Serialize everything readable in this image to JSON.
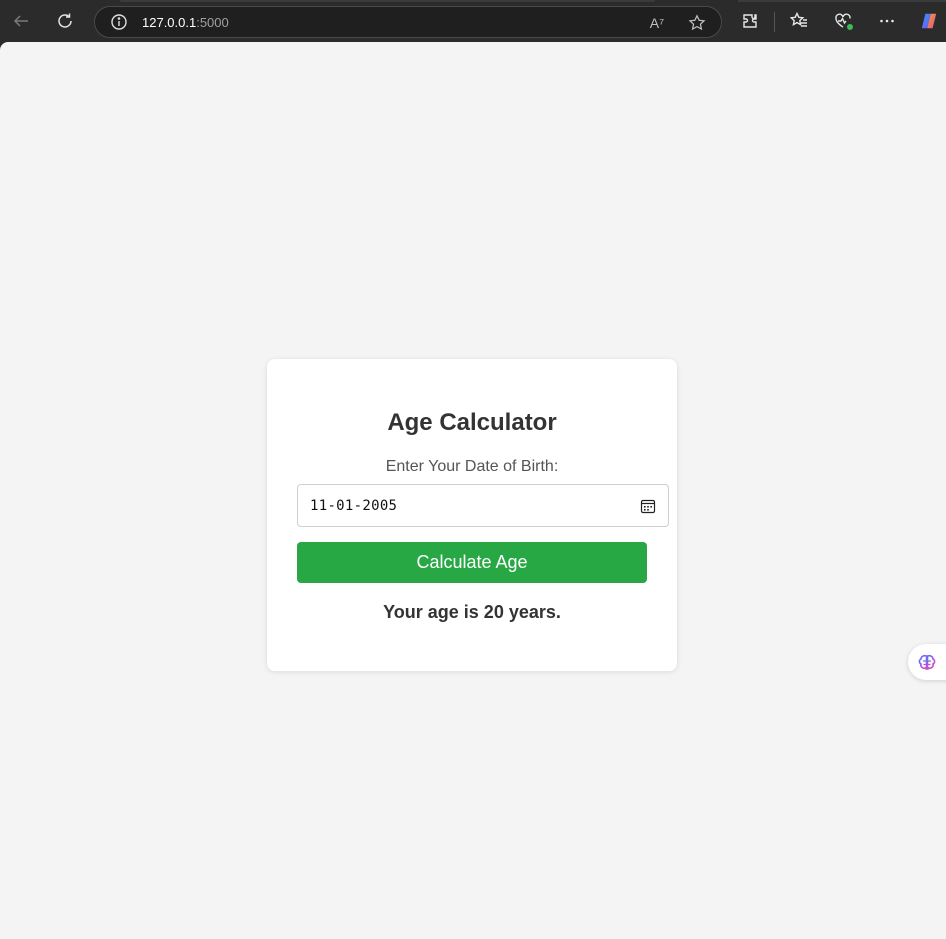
{
  "browser": {
    "url_host": "127.0.0.1",
    "url_port": ":5000",
    "icons": {
      "back": "back-arrow-icon",
      "reload": "reload-icon",
      "info": "info-icon",
      "read_aloud": "read-aloud-icon",
      "favorite": "star-icon",
      "extensions": "extensions-icon",
      "favorites": "favorites-icon",
      "health": "browser-essentials-icon",
      "more": "more-icon",
      "copilot": "copilot-icon"
    },
    "read_aloud_glyph": "A⁷"
  },
  "app": {
    "title": "Age Calculator",
    "dob_label": "Enter Your Date of Birth:",
    "dob_value": "11-01-2005",
    "calculate_label": "Calculate Age",
    "result": "Your age is 20 years."
  },
  "colors": {
    "page_background": "#f4f4f4",
    "card_background": "#ffffff",
    "button": "#28a745",
    "text": "#333333"
  }
}
